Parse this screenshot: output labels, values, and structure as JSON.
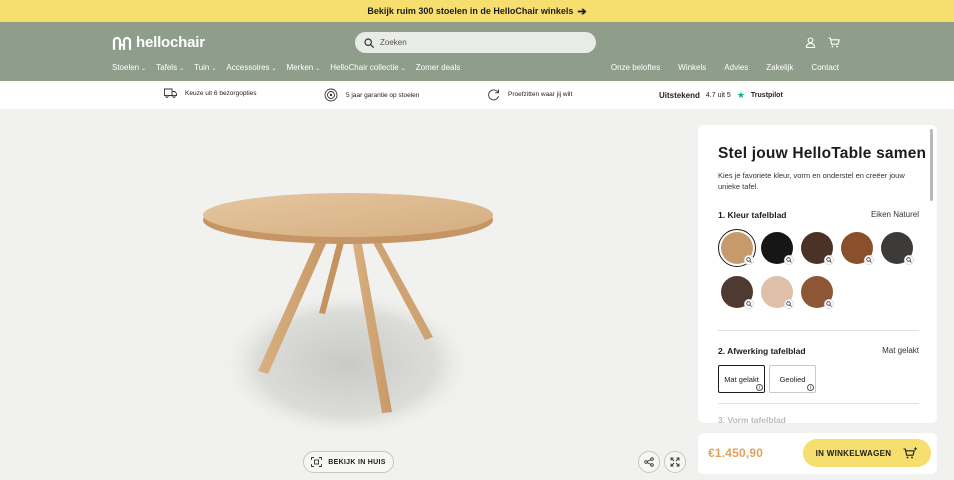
{
  "promo": {
    "text": "Bekijk ruim 300 stoelen in de HelloChair winkels"
  },
  "header": {
    "logo": "hellochair",
    "search_placeholder": "Zoeken",
    "nav": [
      {
        "label": "Stoelen",
        "dropdown": true
      },
      {
        "label": "Tafels",
        "dropdown": true
      },
      {
        "label": "Tuin",
        "dropdown": true
      },
      {
        "label": "Accessoires",
        "dropdown": true
      },
      {
        "label": "Merken",
        "dropdown": true
      },
      {
        "label": "HelloChair collectie",
        "dropdown": true
      },
      {
        "label": "Zomer deals",
        "dropdown": false
      }
    ],
    "nav_right": [
      "Onze beloftes",
      "Winkels",
      "Advies",
      "Zakelijk",
      "Contact"
    ]
  },
  "usp": {
    "items": [
      "Keuze uit 6 bezorgopties",
      "5 jaar garantie op stoelen",
      "Proefzitten waar jij wilt"
    ],
    "trust_label": "Uitstekend",
    "trust_score": "4.7 uit 5",
    "trust_brand": "Trustpilot",
    "trust_color": "#00b67a"
  },
  "viewer": {
    "ar_button": "BEKIJK IN HUIS"
  },
  "configurator": {
    "title": "Stel jouw HelloTable samen",
    "description": "Kies je favoriete kleur, vorm en onderstel en creëer jouw unieke tafel.",
    "step1": {
      "label": "1.  Kleur tafelblad",
      "value": "Eiken Naturel"
    },
    "swatches": [
      "#c79a6c",
      "#161616",
      "#4b3226",
      "#8a4f2d",
      "#3d3b39",
      "#4e3a30",
      "#dfbfa8",
      "#8d5735"
    ],
    "step2": {
      "label": "2.  Afwerking tafelblad",
      "value": "Mat gelakt"
    },
    "finish_options": [
      "Mat gelakt",
      "Geolied"
    ],
    "step3_partial": "3.  Vorm tafelblad"
  },
  "buy": {
    "price": "€1.450,90",
    "cart_button": "IN WINKELWAGEN",
    "accent": "#f7df6f",
    "price_color": "#e0a25a"
  }
}
